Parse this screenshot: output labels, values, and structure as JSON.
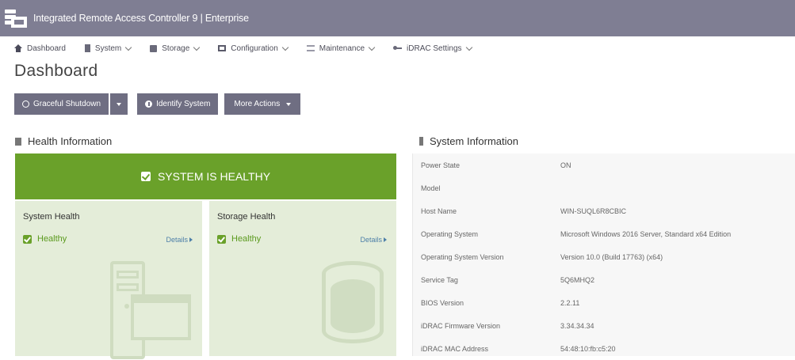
{
  "app": {
    "title": "Integrated Remote Access Controller 9 | Enterprise"
  },
  "nav": {
    "items": [
      {
        "label": "Dashboard"
      },
      {
        "label": "System"
      },
      {
        "label": "Storage"
      },
      {
        "label": "Configuration"
      },
      {
        "label": "Maintenance"
      },
      {
        "label": "iDRAC Settings"
      }
    ]
  },
  "page": {
    "title": "Dashboard"
  },
  "actions": {
    "graceful_shutdown": "Graceful Shutdown",
    "identify_system": "Identify System",
    "more_actions": "More Actions"
  },
  "health": {
    "heading": "Health Information",
    "banner": "SYSTEM IS HEALTHY",
    "cards": [
      {
        "title": "System Health",
        "status": "Healthy",
        "details": "Details"
      },
      {
        "title": "Storage Health",
        "status": "Healthy",
        "details": "Details"
      }
    ]
  },
  "system_info": {
    "heading": "System Information",
    "rows": [
      {
        "key": "Power State",
        "value": "ON"
      },
      {
        "key": "Model",
        "value": ""
      },
      {
        "key": "Host Name",
        "value": "WIN-SUQL6R8CBIC"
      },
      {
        "key": "Operating System",
        "value": "Microsoft Windows 2016 Server, Standard x64 Edition"
      },
      {
        "key": "Operating System Version",
        "value": "Version 10.0 (Build 17763) (x64)"
      },
      {
        "key": "Service Tag",
        "value": "5Q6MHQ2"
      },
      {
        "key": "BIOS Version",
        "value": "2.2.11"
      },
      {
        "key": "iDRAC Firmware Version",
        "value": "3.34.34.34"
      },
      {
        "key": "iDRAC MAC Address",
        "value": "54:48:10:fb:c5:20"
      }
    ]
  },
  "colors": {
    "topbar": "#7f7e93",
    "button": "#6f6e82",
    "healthy_green": "#6aa12a",
    "card_bg": "#e4edd9",
    "info_bg": "#f7f7f7"
  }
}
